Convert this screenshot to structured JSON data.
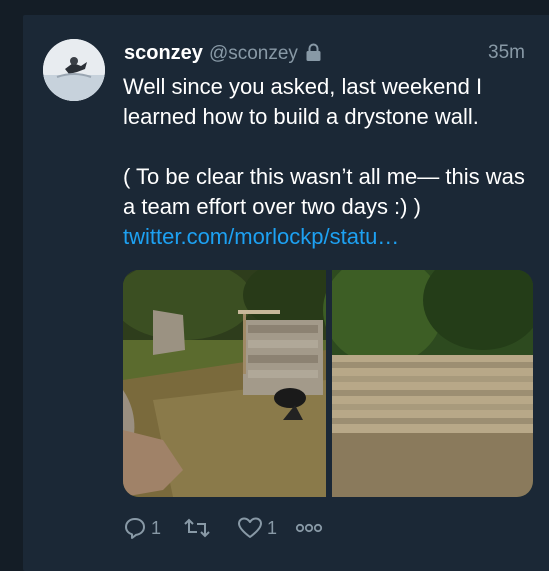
{
  "tweet": {
    "display_name": "sconzey",
    "handle": "@sconzey",
    "timestamp": "35m",
    "protected_icon": "lock-icon",
    "text_line1": "Well since you asked, last weekend I learned how to build a drystone wall.",
    "text_line2": "( To be clear this wasn’t all me— this was a team effort over two days :) )",
    "link": "twitter.com/morlockp/statu…"
  },
  "actions": {
    "reply_count": "1",
    "like_count": "1",
    "reply_icon": "reply-icon",
    "retweet_icon": "retweet-icon",
    "like_icon": "heart-icon",
    "more_icon": "more-icon"
  },
  "colors": {
    "background": "#141d26",
    "card": "#1b2836",
    "secondary_text": "#8899a6",
    "link": "#1da1f2"
  }
}
